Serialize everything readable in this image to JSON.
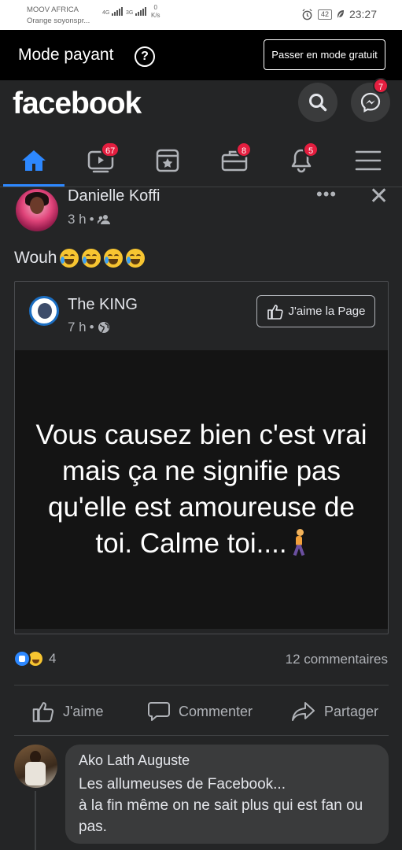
{
  "status_bar": {
    "carrier_line1": "MOOV AFRICA",
    "carrier_line2": "Orange soyonspr...",
    "net1": "4G",
    "net2": "3G",
    "speed_value": "0",
    "speed_unit": "K/s",
    "battery": "42",
    "time": "23:27"
  },
  "mode_bar": {
    "title": "Mode payant",
    "help_icon": "?",
    "free_mode_button": "Passer en mode gratuit"
  },
  "header": {
    "logo": "facebook",
    "messenger_badge": "7"
  },
  "tabs": [
    {
      "name": "home",
      "badge": ""
    },
    {
      "name": "watch",
      "badge": "67"
    },
    {
      "name": "pages",
      "badge": ""
    },
    {
      "name": "marketplace",
      "badge": "8"
    },
    {
      "name": "notifications",
      "badge": "5"
    },
    {
      "name": "menu",
      "badge": ""
    }
  ],
  "post": {
    "author": "Danielle Koffi",
    "time": "3 h",
    "separator": "•",
    "text": "Wouh",
    "shared": {
      "page_name": "The KING",
      "time": "7 h",
      "like_page_button": "J'aime la Page",
      "quote_text": "Vous causez bien c'est vrai mais ça ne signifie pas qu'elle est amoureuse de toi. Calme toi...."
    },
    "reaction_count": "4",
    "comment_count": "12 commentaires",
    "actions": {
      "like": "J'aime",
      "comment": "Commenter",
      "share": "Partager"
    }
  },
  "comment": {
    "author": "Ako Lath Auguste",
    "text": "Les allumeuses de Facebook...\nà la fin même on ne sait plus qui est fan ou pas."
  },
  "colors": {
    "background": "#242526",
    "accent": "#2d88ff",
    "badge": "#e41e3f"
  }
}
